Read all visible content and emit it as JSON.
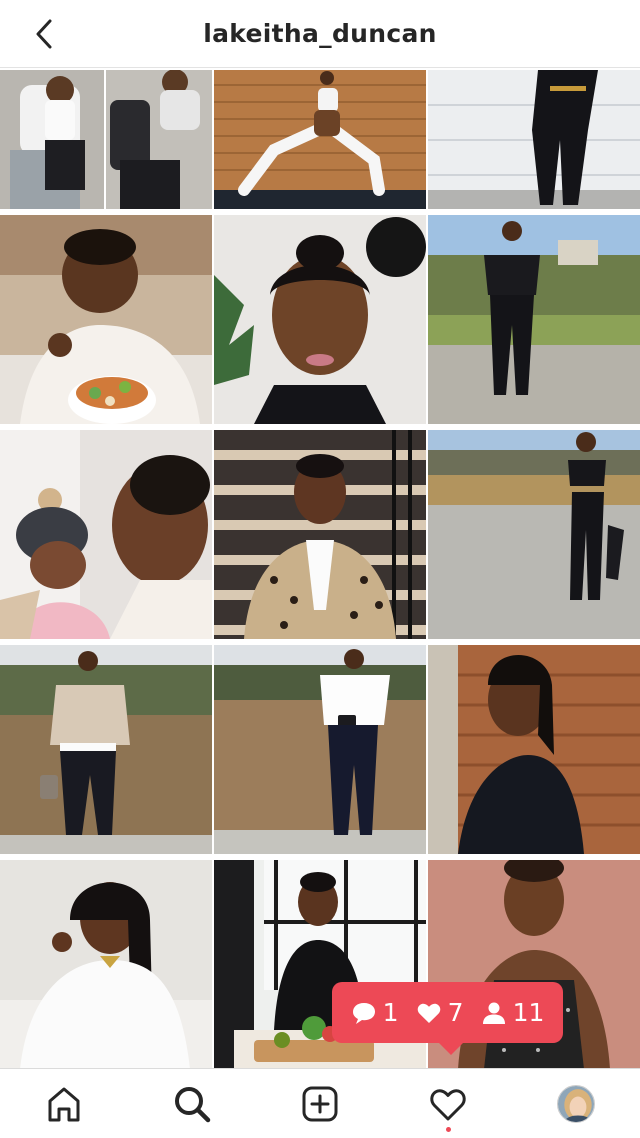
{
  "header": {
    "username": "lakeitha_duncan",
    "back_icon": "chevron-left-icon"
  },
  "grid": {
    "tiles": [
      {
        "name": "post-mother-child-bench"
      },
      {
        "name": "post-lunge-pose"
      },
      {
        "name": "post-black-leggings-garage"
      },
      {
        "name": "post-eating-salad"
      },
      {
        "name": "post-closeup-portrait"
      },
      {
        "name": "post-outdoor-fitness-pose"
      },
      {
        "name": "post-kissing-child"
      },
      {
        "name": "post-leopard-jacket-stairs"
      },
      {
        "name": "post-black-crop-top-outdoors"
      },
      {
        "name": "post-turtleneck-outfit"
      },
      {
        "name": "post-white-shirt-outfit"
      },
      {
        "name": "post-black-jacket-wood-wall"
      },
      {
        "name": "post-white-top-smiling"
      },
      {
        "name": "post-kitchen-cooking"
      },
      {
        "name": "post-polka-dot-top"
      }
    ]
  },
  "activity": {
    "comments": "1",
    "likes": "7",
    "followers": "11",
    "color": "#ed4956"
  },
  "nav": {
    "items": [
      "home-icon",
      "search-icon",
      "add-post-icon",
      "heart-icon",
      "profile-avatar"
    ],
    "notification_color": "#ed4956"
  }
}
